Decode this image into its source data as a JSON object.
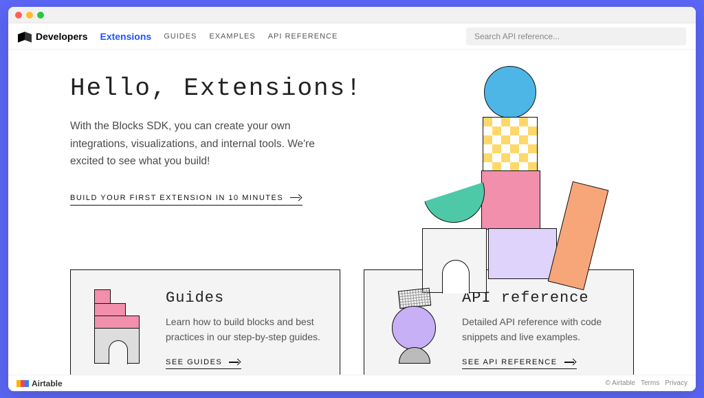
{
  "nav": {
    "brand": "Developers",
    "brand_ext": "Extensions",
    "links": [
      "GUIDES",
      "EXAMPLES",
      "API REFERENCE"
    ],
    "search_placeholder": "Search API reference..."
  },
  "hero": {
    "title": "Hello, Extensions!",
    "description": "With the Blocks SDK, you can create your own integrations, visualizations, and internal tools. We're excited to see what you build!",
    "cta": "BUILD YOUR FIRST EXTENSION IN 10 MINUTES"
  },
  "cards": [
    {
      "title": "Guides",
      "description": "Learn how to build blocks and best practices in our step-by-step guides.",
      "cta": "SEE GUIDES"
    },
    {
      "title": "API reference",
      "description": "Detailed API reference with code snippets and live examples.",
      "cta": "SEE API REFERENCE"
    }
  ],
  "footer": {
    "brand": "Airtable",
    "copyright": "© Airtable",
    "links": [
      "Terms",
      "Privacy"
    ]
  }
}
